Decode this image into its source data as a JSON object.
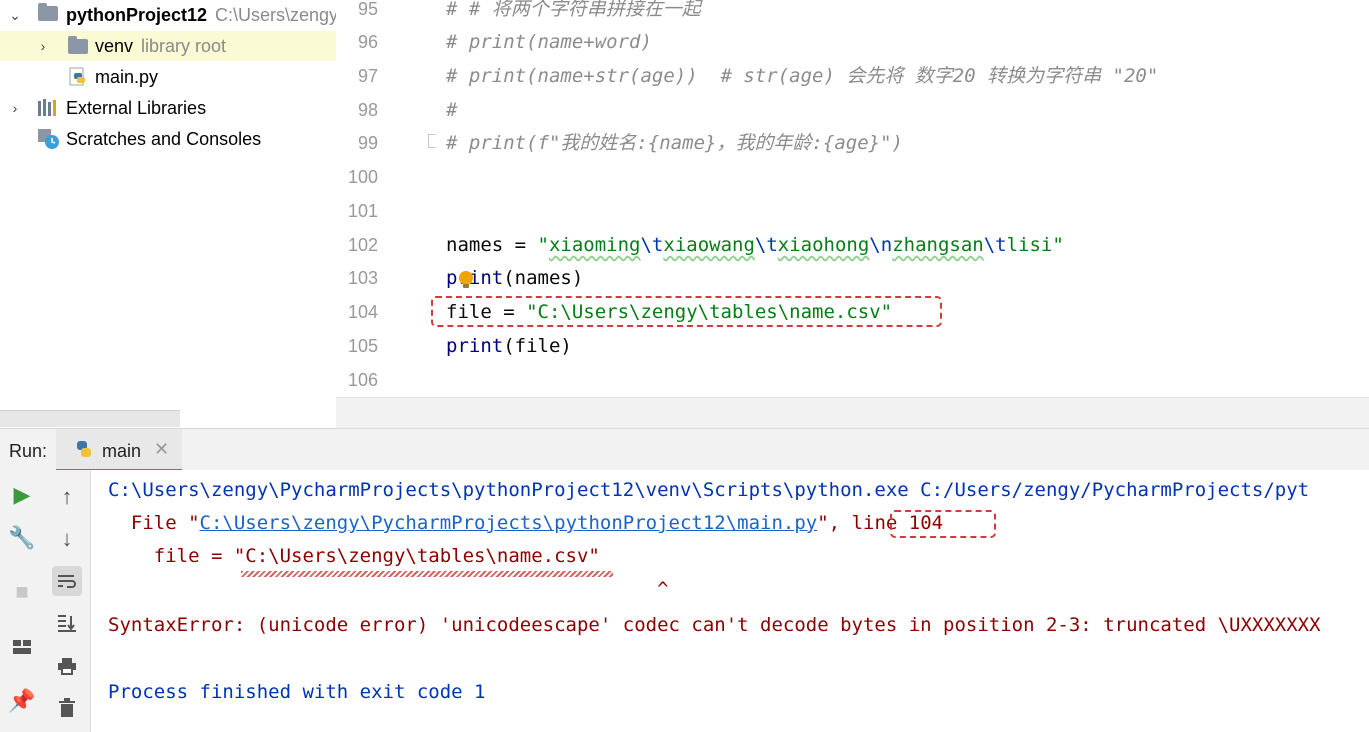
{
  "project_tree": {
    "root": {
      "name": "pythonProject12",
      "path": "C:\\Users\\zengy"
    },
    "venv": {
      "name": "venv",
      "hint": "library root"
    },
    "main_file": "main.py",
    "external_libraries": "External Libraries",
    "scratches": "Scratches and Consoles"
  },
  "editor": {
    "line_numbers": [
      "95",
      "96",
      "97",
      "98",
      "99",
      "100",
      "101",
      "102",
      "103",
      "104",
      "105",
      "106"
    ],
    "lines": {
      "l95": "# # 将两个字符串拼接在一起",
      "l96": "# print(name+word)",
      "l97": "# print(name+str(age))  # str(age) 会先将 数字20 转换为字符串 \"20\"",
      "l98": "#",
      "l99": "# print(f\"我的姓名:{name}，我的年龄:{age}\")",
      "l102": {
        "var": "names = ",
        "q1": "\"",
        "s1": "xiaoming",
        "e1": "\\t",
        "s2": "xiaowang",
        "e2": "\\t",
        "s3": "xiaohong",
        "e3": "\\n",
        "s4": "zhangsan",
        "e4": "\\t",
        "s5": "lisi",
        "q2": "\""
      },
      "l103": {
        "fn": "print",
        "args": "(names)"
      },
      "l104": {
        "var": "file = ",
        "str": "\"C:\\Users\\zengy\\tables\\name.csv\""
      },
      "l105": {
        "fn": "print",
        "args": "(file)"
      }
    }
  },
  "run_panel": {
    "label": "Run:",
    "tab_name": "main",
    "console": {
      "cmd": "C:\\Users\\zengy\\PycharmProjects\\pythonProject12\\venv\\Scripts\\python.exe C:/Users/zengy/PycharmProjects/pyt",
      "file_prefix": "  File \"",
      "file_link": "C:\\Users\\zengy\\PycharmProjects\\pythonProject12\\main.py",
      "file_suffix": "\", ",
      "line_ref": "line 104",
      "code_line": "    file = \"C:\\Users\\zengy\\tables\\name.csv\"",
      "caret": "                                                ^",
      "error": "SyntaxError: (unicode error) 'unicodeescape' codec can't decode bytes in position 2-3: truncated \\UXXXXXXX",
      "finished": "Process finished with exit code 1"
    }
  },
  "icons": {
    "run": "play-icon",
    "wrench": "wrench-icon",
    "stop": "stop-icon",
    "layout": "layout-icon",
    "pin": "pin-icon",
    "up": "arrow-up-icon",
    "down": "arrow-down-icon",
    "wrap": "soft-wrap-icon",
    "scroll": "scroll-to-end-icon",
    "print": "print-icon",
    "trash": "trash-icon"
  }
}
